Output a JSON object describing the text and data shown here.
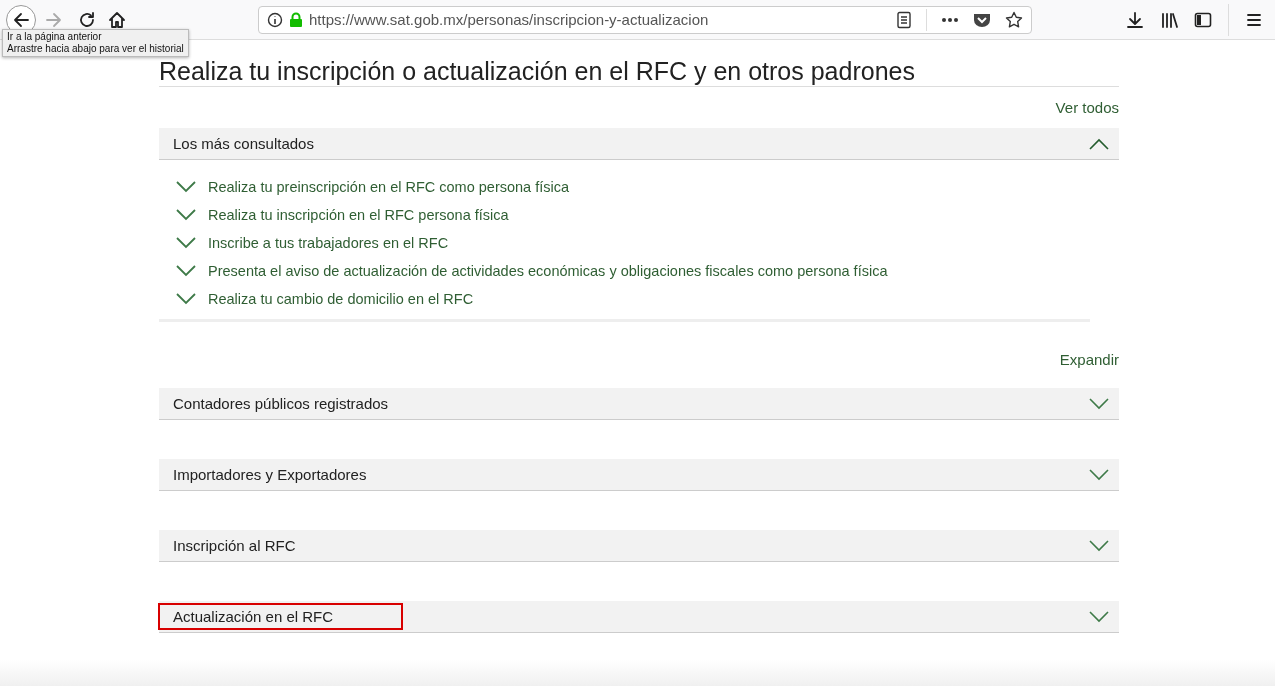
{
  "browser": {
    "url": "https://www.sat.gob.mx/personas/inscripcion-y-actualizacion",
    "back_enabled": true,
    "forward_enabled": false,
    "tooltip": [
      "Ir a la página anterior",
      "Arrastre hacia abajo para ver el historial"
    ]
  },
  "page": {
    "title": "Realiza tu inscripción o actualización en el RFC y en otros padrones",
    "view_all": "Ver todos",
    "expand_all": "Expandir",
    "featured": {
      "title": "Los más consultados",
      "expanded": true,
      "items": [
        {
          "label": "Realiza tu preinscripción en el RFC como persona física"
        },
        {
          "label": "Realiza tu inscripción en el RFC persona física"
        },
        {
          "label": "Inscribe a tus trabajadores en el RFC"
        },
        {
          "label": "Presenta el aviso de actualización de actividades económicas y obligaciones fiscales como persona física"
        },
        {
          "label": "Realiza tu cambio de domicilio en el RFC"
        }
      ]
    },
    "sections": [
      {
        "title": "Contadores públicos registrados",
        "expanded": false,
        "highlighted": false
      },
      {
        "title": "Importadores y Exportadores",
        "expanded": false,
        "highlighted": false
      },
      {
        "title": "Inscripción al RFC",
        "expanded": false,
        "highlighted": false
      },
      {
        "title": "Actualización en el RFC",
        "expanded": false,
        "highlighted": true
      }
    ]
  }
}
